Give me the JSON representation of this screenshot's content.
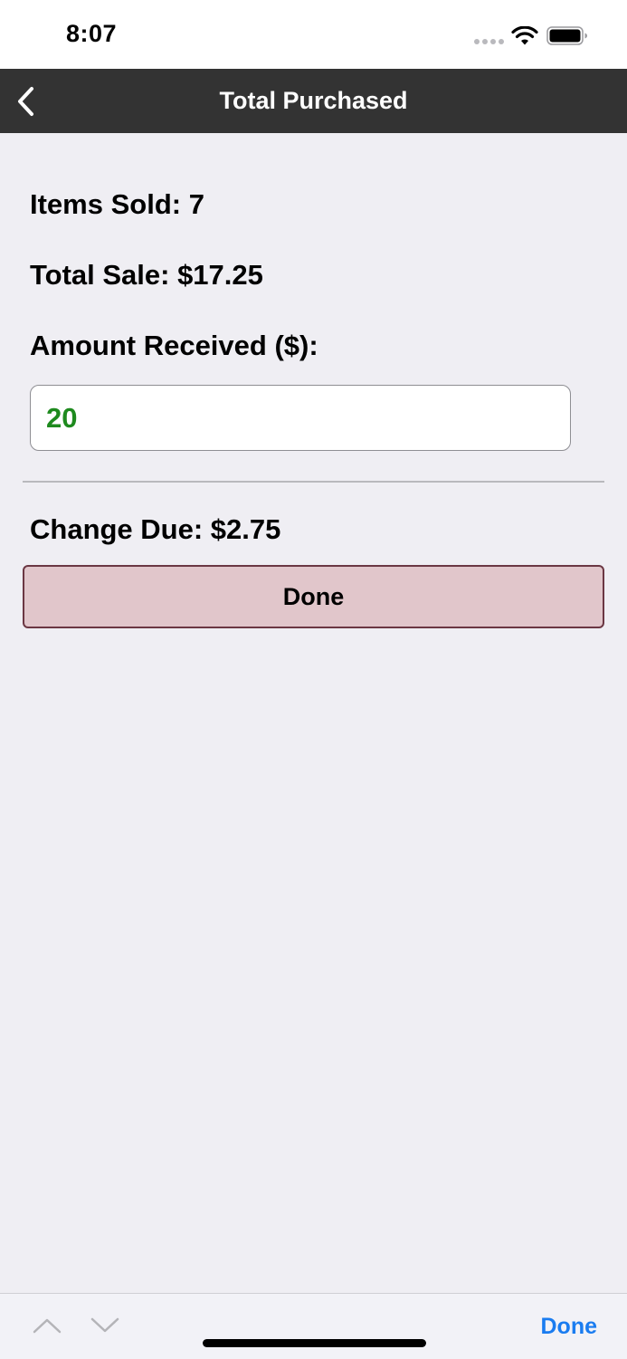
{
  "status_bar": {
    "time": "8:07"
  },
  "nav": {
    "title": "Total Purchased",
    "back_icon": "chevron-left-icon"
  },
  "summary": {
    "items_sold": "Items Sold: 7",
    "total_sale": "Total Sale: $17.25",
    "amount_received_label": "Amount Received ($):",
    "amount_received_value": "20",
    "change_due": "Change Due: $2.75"
  },
  "actions": {
    "done_label": "Done"
  },
  "keyboard_toolbar": {
    "up_icon": "chevron-up-icon",
    "down_icon": "chevron-down-icon",
    "done_label": "Done"
  },
  "colors": {
    "nav_background": "#333333",
    "page_background": "#efeef3",
    "input_text": "#1e8a1e",
    "done_button_fill": "#e1c6cb",
    "done_button_border": "#6b3743",
    "toolbar_done": "#1a7cf0"
  }
}
